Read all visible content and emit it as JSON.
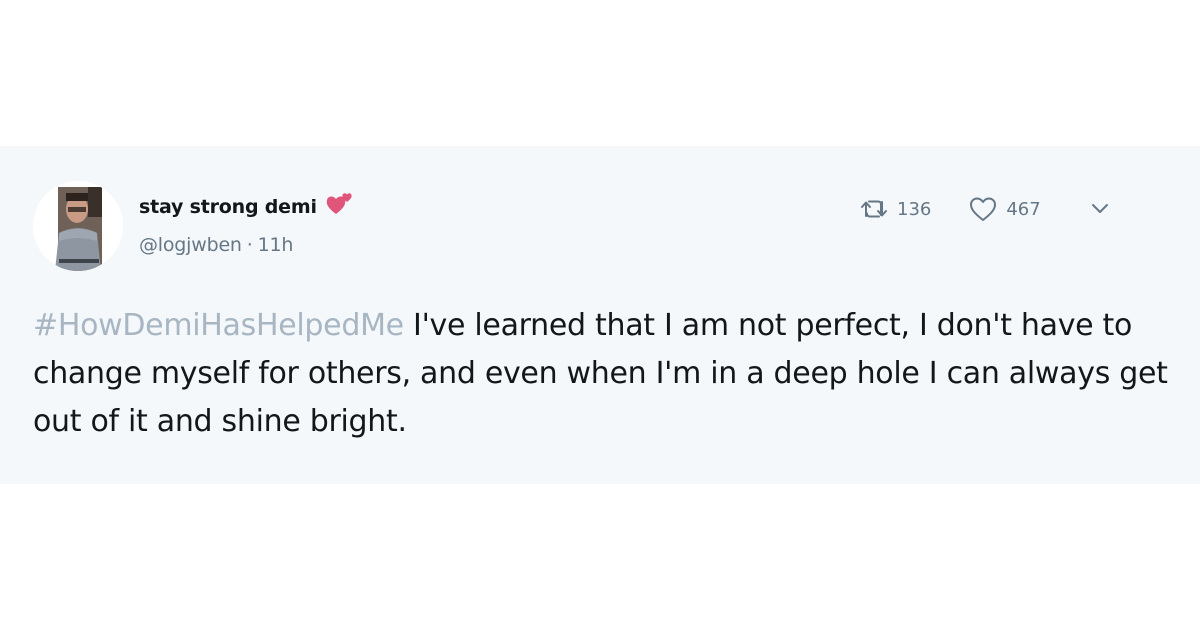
{
  "tweet": {
    "author": {
      "display_name": "stay strong demi",
      "name_emoji": "two-hearts-emoji",
      "handle": "@logjwben",
      "separator": "·",
      "timestamp": "11h"
    },
    "actions": {
      "retweet_icon": "retweet-icon",
      "retweet_count": "136",
      "like_icon": "heart-outline-icon",
      "like_count": "467",
      "menu_icon": "chevron-down-icon"
    },
    "body": {
      "hashtag": "#HowDemiHasHelpedMe",
      "text": " I've learned that I am not perfect, I don't have to change myself for others, and even when I'm in a deep hole I can always get out of it and shine bright."
    }
  },
  "colors": {
    "card_background": "#f5f8fa",
    "text_primary": "#14171a",
    "text_secondary": "#657786",
    "hashtag": "#a7b6c2",
    "heart_emoji": "#e0557a"
  }
}
